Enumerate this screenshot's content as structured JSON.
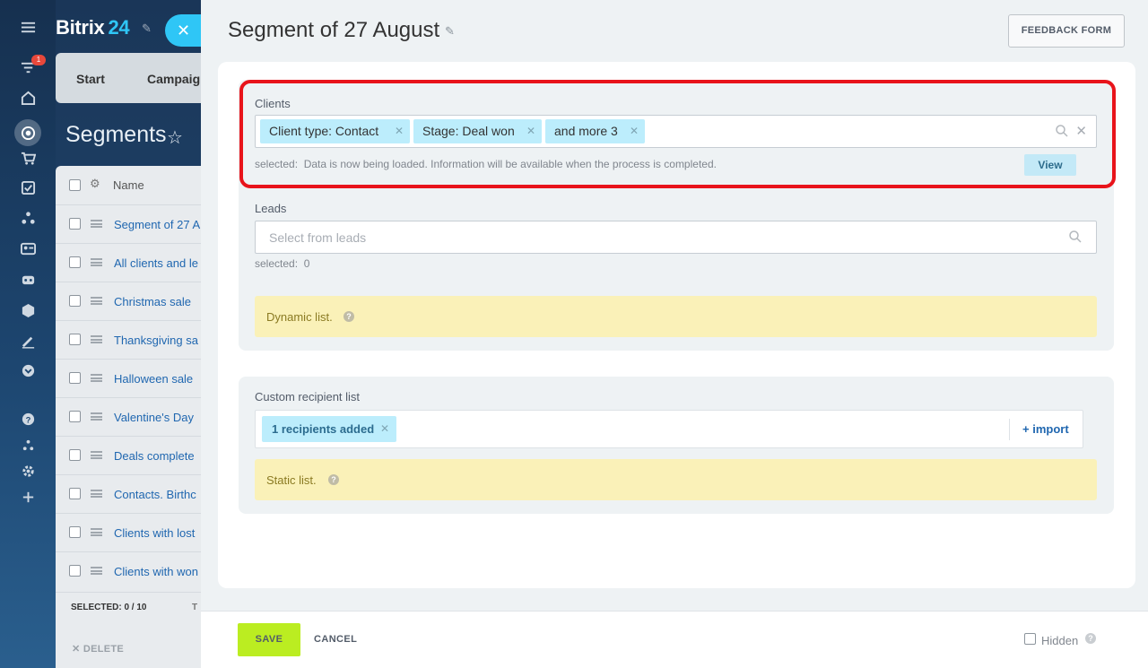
{
  "app": {
    "logo_name": "Bitrix",
    "logo_num": "24",
    "notification_count": "1"
  },
  "background": {
    "tabs": [
      "Start",
      "Campaig"
    ],
    "title": "Segments",
    "table_header": "Name",
    "rows": [
      "Segment of 27 A",
      "All clients and le",
      "Christmas sale",
      "Thanksgiving sa",
      "Halloween sale",
      "Valentine's Day",
      "Deals complete",
      "Contacts. Birthc",
      "Clients with lost",
      "Clients with won"
    ],
    "selected_label": "SELECTED:",
    "selected_value": "0 / 10",
    "total_abbrev": "T",
    "delete_label": "DELETE"
  },
  "panel": {
    "title": "Segment of 27 August",
    "feedback_label": "FEEDBACK FORM"
  },
  "clients": {
    "label": "Clients",
    "chips": [
      "Client type: Contact",
      "Stage: Deal won",
      "and more 3"
    ],
    "selected_prefix": "selected:",
    "selected_text": "Data is now being loaded. Information will be available when the process is completed.",
    "view_label": "View"
  },
  "leads": {
    "label": "Leads",
    "placeholder": "Select from leads",
    "selected_prefix": "selected:",
    "selected_value": "0"
  },
  "dynamic": {
    "text": "Dynamic list."
  },
  "custom": {
    "label": "Custom recipient list",
    "chip": "1 recipients added",
    "import_label": "+ import"
  },
  "static": {
    "text": "Static list."
  },
  "footer": {
    "save_label": "SAVE",
    "cancel_label": "CANCEL",
    "hidden_label": "Hidden"
  },
  "colors": {
    "accent": "#2fc6f6",
    "chip": "#bcedfc",
    "save": "#bbed21",
    "highlight": "#e8141b",
    "hint": "#faf1b8"
  }
}
